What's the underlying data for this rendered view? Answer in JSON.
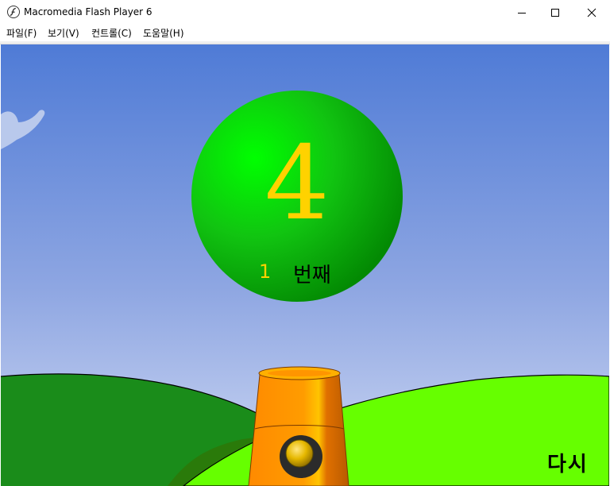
{
  "window": {
    "title": "Macromedia Flash Player 6",
    "icon": "flash-player-icon",
    "controls": [
      "minimize-icon",
      "maximize-icon",
      "close-icon"
    ]
  },
  "menu": {
    "items": [
      {
        "label": "파일(F)"
      },
      {
        "label": "보기(V)"
      },
      {
        "label": "컨트롤(C)"
      },
      {
        "label": "도움말(H)"
      }
    ]
  },
  "game": {
    "number": "4",
    "round_number": "1",
    "round_label": "번째",
    "retry_label": "다시",
    "colors": {
      "sky_top": "#4f7bd6",
      "sky_bottom": "#c8d4f2",
      "ball": "#11c811",
      "number": "#ffd200",
      "cannon": "#ff9800",
      "hill_light": "#66ff00",
      "hill_dark": "#1a8c1a"
    }
  }
}
